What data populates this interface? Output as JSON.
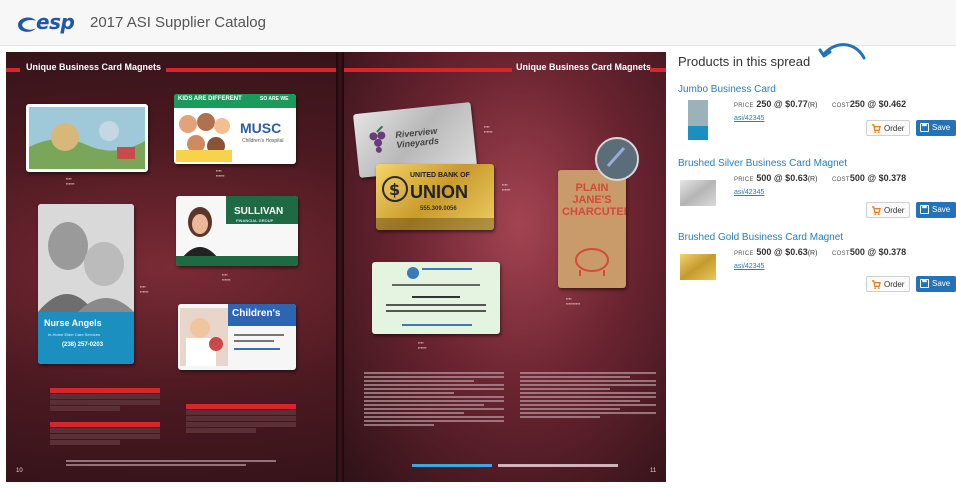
{
  "header": {
    "logo_text": "esp",
    "catalog_title": "2017 ASI Supplier Catalog"
  },
  "spread": {
    "left_section_title": "Unique Business Card Magnets",
    "right_section_title": "Unique Business Card Magnets",
    "left_page_number": "10",
    "right_page_number": "11",
    "card_texts": {
      "kids": "KIDS ARE DIFFERENT",
      "kids_sub": "SO ARE WE",
      "musc": "MUSC",
      "musc_sub": "Children's Hospital",
      "sullivan": "SULLIVAN",
      "sullivan_sub": "FINANCIAL GROUP",
      "nurse": "Nurse Angels",
      "nurse_sub": "In-Home Elder Care Services",
      "nurse_phone": "(238) 257-0203",
      "childrens": "Children's",
      "riverview": "Riverview Vineyards",
      "union_top": "UNITED BANK OF",
      "union": "UNION",
      "union_phone": "555.309.0056",
      "plain": "PLAIN JANE'S CHARCUTERIE"
    }
  },
  "panel": {
    "title": "Products in this spread",
    "products": [
      {
        "name": "Jumbo Business Card",
        "price_label": "PRICE",
        "price_qty": "250",
        "price_value": "@ $0.77",
        "price_code": "(R)",
        "cost_label": "COST",
        "cost_qty": "250",
        "cost_value": "@ $0.462",
        "asi": "asi/42345",
        "order_label": "Order",
        "save_label": "Save"
      },
      {
        "name": "Brushed Silver Business Card Magnet",
        "price_label": "PRICE",
        "price_qty": "500",
        "price_value": "@ $0.63",
        "price_code": "(R)",
        "cost_label": "COST",
        "cost_qty": "500",
        "cost_value": "@ $0.378",
        "asi": "asi/42345",
        "order_label": "Order",
        "save_label": "Save"
      },
      {
        "name": "Brushed Gold Business Card Magnet",
        "price_label": "PRICE",
        "price_qty": "500",
        "price_value": "@ $0.63",
        "price_code": "(R)",
        "cost_label": "COST",
        "cost_qty": "500",
        "cost_value": "@ $0.378",
        "asi": "asi/42345",
        "order_label": "Order",
        "save_label": "Save"
      }
    ]
  },
  "colors": {
    "brand_blue": "#1f58a7",
    "link_blue": "#2b7bbf",
    "save_blue": "#2373bb",
    "catalog_red": "#d7262b",
    "cart_orange": "#e8821e"
  },
  "icons": [
    "esp-logo-icon",
    "curved-arrow-icon",
    "cart-icon",
    "save-disk-icon"
  ]
}
